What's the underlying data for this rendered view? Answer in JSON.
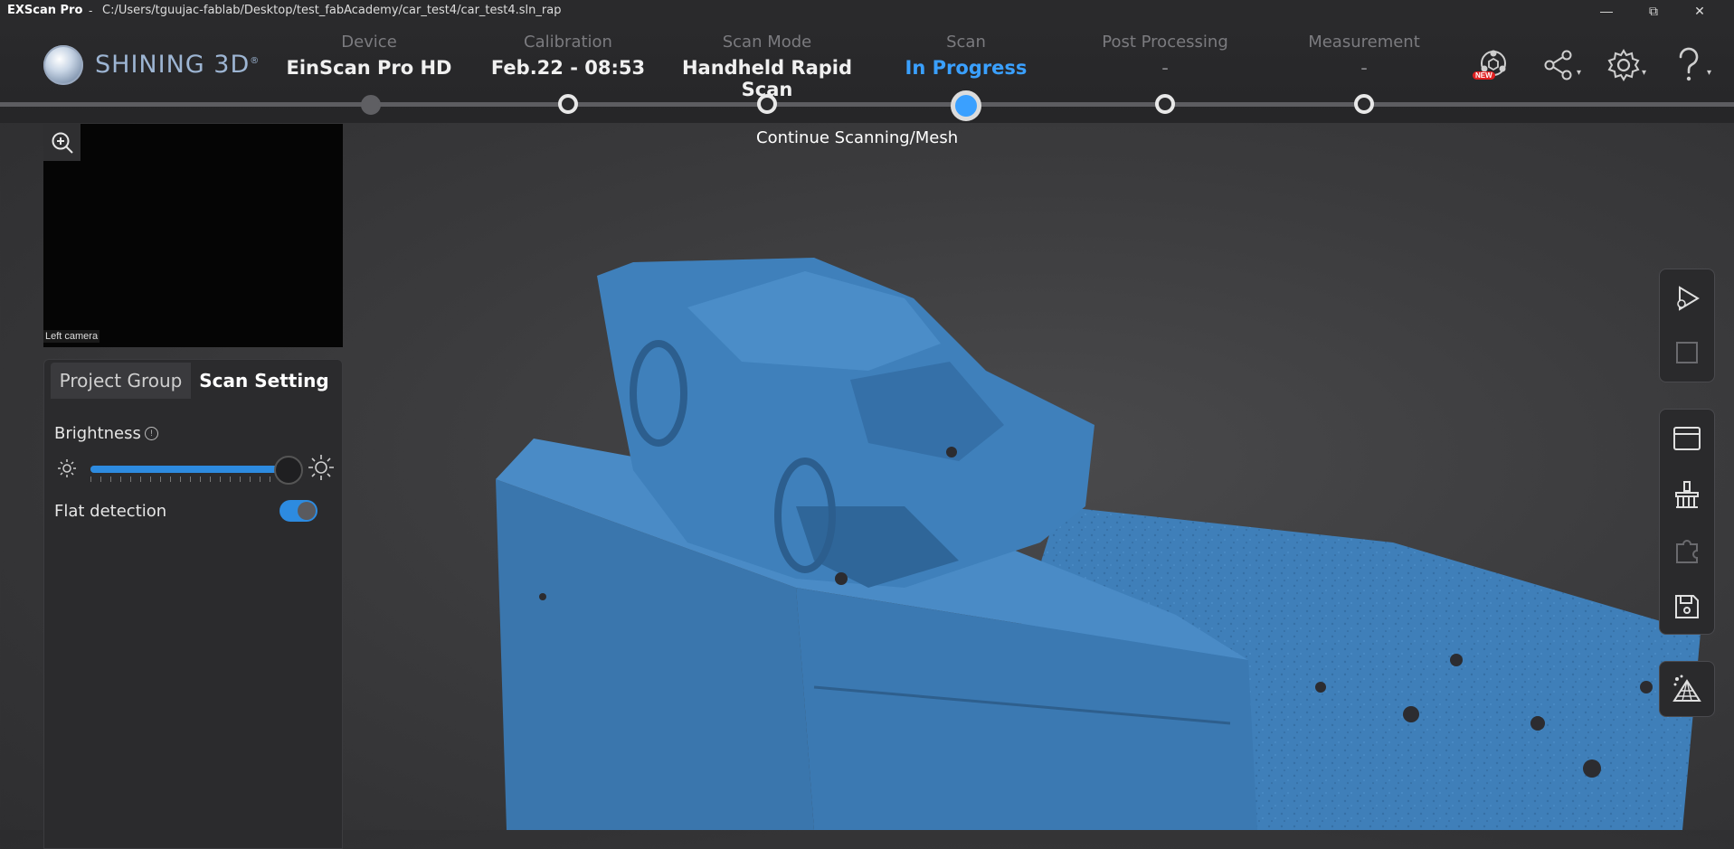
{
  "window": {
    "app_name": "EXScan Pro",
    "separator": "-",
    "file_path": "C:/Users/tguujac-fablab/Desktop/test_fabAcademy/car_test4/car_test4.sln_rap",
    "controls": {
      "minimize": "—",
      "restore": "⧉",
      "close": "✕"
    }
  },
  "brand": {
    "name": "SHINING 3D",
    "mark": "®"
  },
  "steps": [
    {
      "label": "Device",
      "value": "EinScan Pro HD",
      "state": "done"
    },
    {
      "label": "Calibration",
      "value": "Feb.22 - 08:53",
      "state": "pending"
    },
    {
      "label": "Scan Mode",
      "value": "Handheld Rapid Scan",
      "state": "pending"
    },
    {
      "label": "Scan",
      "value": "In Progress",
      "state": "active"
    },
    {
      "label": "Post Processing",
      "value": "-",
      "state": "pending"
    },
    {
      "label": "Measurement",
      "value": "-",
      "state": "pending"
    }
  ],
  "progress_hint": "Continue Scanning/Mesh",
  "header_tools": {
    "new_badge": "NEW",
    "caret": "▾"
  },
  "camera": {
    "label": "Left camera"
  },
  "panel": {
    "tabs": [
      "Project Group",
      "Scan Setting"
    ],
    "active_tab": "Scan Setting",
    "brightness": {
      "label": "Brightness",
      "info": "!",
      "level_fraction": 0.95
    },
    "flat_detection": {
      "label": "Flat detection",
      "enabled": true
    }
  },
  "colors": {
    "accent": "#3aa0ff",
    "scan_model": "#3f7fb9",
    "background": "#3b3b3d"
  }
}
